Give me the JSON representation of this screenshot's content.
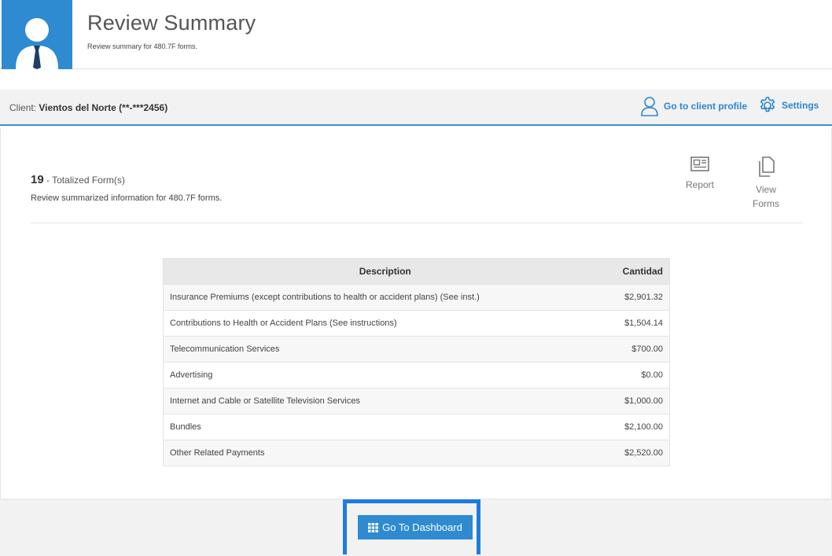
{
  "header": {
    "title": "Review Summary",
    "subtitle": "Review summary for 480.7F forms.",
    "avatar_icon": "user-avatar-icon",
    "accent_color": "#2e8bd2"
  },
  "client_bar": {
    "label_prefix": "Client: ",
    "client_name": "Vientos del Norte (**-***2456)",
    "profile_link": "Go to client profile",
    "profile_icon": "user-outline-icon",
    "settings_link": "Settings",
    "settings_icon": "gear-icon"
  },
  "summary": {
    "count": "19",
    "count_label": " - Totalized Form(s)",
    "description": "Review summarized information for 480.7F forms."
  },
  "actions": {
    "report_label": "Report",
    "report_icon": "newspaper-icon",
    "view_forms_label": "View Forms",
    "view_forms_icon": "copy-icon"
  },
  "table": {
    "headers": [
      "Description",
      "Cantidad"
    ],
    "rows": [
      {
        "description": "Insurance Premiums (except contributions to health or accident plans) (See inst.)",
        "amount": "$2,901.32"
      },
      {
        "description": "Contributions to Health or Accident Plans (See instructions)",
        "amount": "$1,504.14"
      },
      {
        "description": "Telecommunication Services",
        "amount": "$700.00"
      },
      {
        "description": "Advertising",
        "amount": "$0.00"
      },
      {
        "description": "Internet and Cable or Satellite Television Services",
        "amount": "$1,000.00"
      },
      {
        "description": "Bundles",
        "amount": "$2,100.00"
      },
      {
        "description": "Other Related Payments",
        "amount": "$2,520.00"
      }
    ]
  },
  "footer": {
    "dashboard_button": "Go To Dashboard",
    "dashboard_icon": "grid-icon",
    "highlight_color": "#1c7de0"
  }
}
